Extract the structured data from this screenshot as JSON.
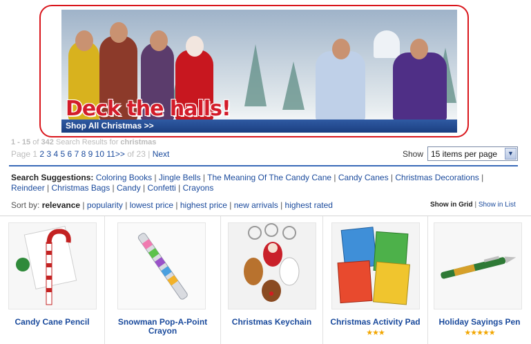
{
  "banner": {
    "headline": "Deck the halls!",
    "cta": "Shop All Christmas >>"
  },
  "results": {
    "range": "1 - 15",
    "of_word": "of",
    "total": "342",
    "label": "Search Results for",
    "query": "christmas"
  },
  "pager": {
    "page_word": "Page",
    "current": "1",
    "pages": [
      "2",
      "3",
      "4",
      "5",
      "6",
      "7",
      "8",
      "9",
      "10",
      "11>>"
    ],
    "of_total": "of 23",
    "separator": "|",
    "next": "Next"
  },
  "per_page": {
    "label": "Show",
    "selected": "15 items per page"
  },
  "suggestions": {
    "label": "Search Suggestions:",
    "items": [
      "Coloring Books",
      "Jingle Bells",
      "The Meaning Of The Candy Cane",
      "Candy Canes",
      "Christmas Decorations",
      "Reindeer",
      "Christmas Bags",
      "Candy",
      "Confetti",
      "Crayons"
    ]
  },
  "sort": {
    "label": "Sort by:",
    "active": "relevance",
    "options": [
      "popularity",
      "lowest price",
      "highest price",
      "new arrivals",
      "highest rated"
    ]
  },
  "view": {
    "grid": "Show in Grid",
    "list": "Show in List"
  },
  "products": [
    {
      "title": "Candy Cane Pencil",
      "stars": ""
    },
    {
      "title": "Snowman Pop-A-Point Crayon",
      "stars": ""
    },
    {
      "title": "Christmas Keychain",
      "stars": ""
    },
    {
      "title": "Christmas Activity Pad",
      "stars": "★★★"
    },
    {
      "title": "Holiday Sayings Pen",
      "stars": "★★★★★"
    }
  ],
  "colors": {
    "link": "#1a4a9c",
    "accent_rule": "#3869b8",
    "banner_highlight": "#d9151b",
    "headline_red": "#d31c2a",
    "star": "#f2a600"
  }
}
